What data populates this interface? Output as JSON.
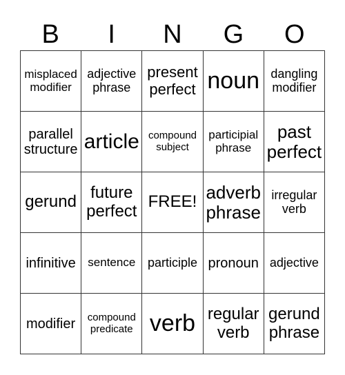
{
  "header": {
    "letters": [
      "B",
      "I",
      "N",
      "G",
      "O"
    ]
  },
  "card": {
    "rows": [
      [
        "misplaced modifier",
        "adjective phrase",
        "present perfect",
        "noun",
        "dangling modifier"
      ],
      [
        "parallel structure",
        "article",
        "compound subject",
        "participial phrase",
        "past perfect"
      ],
      [
        "gerund",
        "future perfect",
        "FREE!",
        "adverb phrase",
        "irregular verb"
      ],
      [
        "infinitive",
        "sentence",
        "participle",
        "pronoun",
        "adjective"
      ],
      [
        "modifier",
        "compound predicate",
        "verb",
        "regular verb",
        "gerund phrase"
      ]
    ]
  },
  "colors": {
    "grid_line": "#333333",
    "text": "#000000",
    "background": "#ffffff"
  }
}
